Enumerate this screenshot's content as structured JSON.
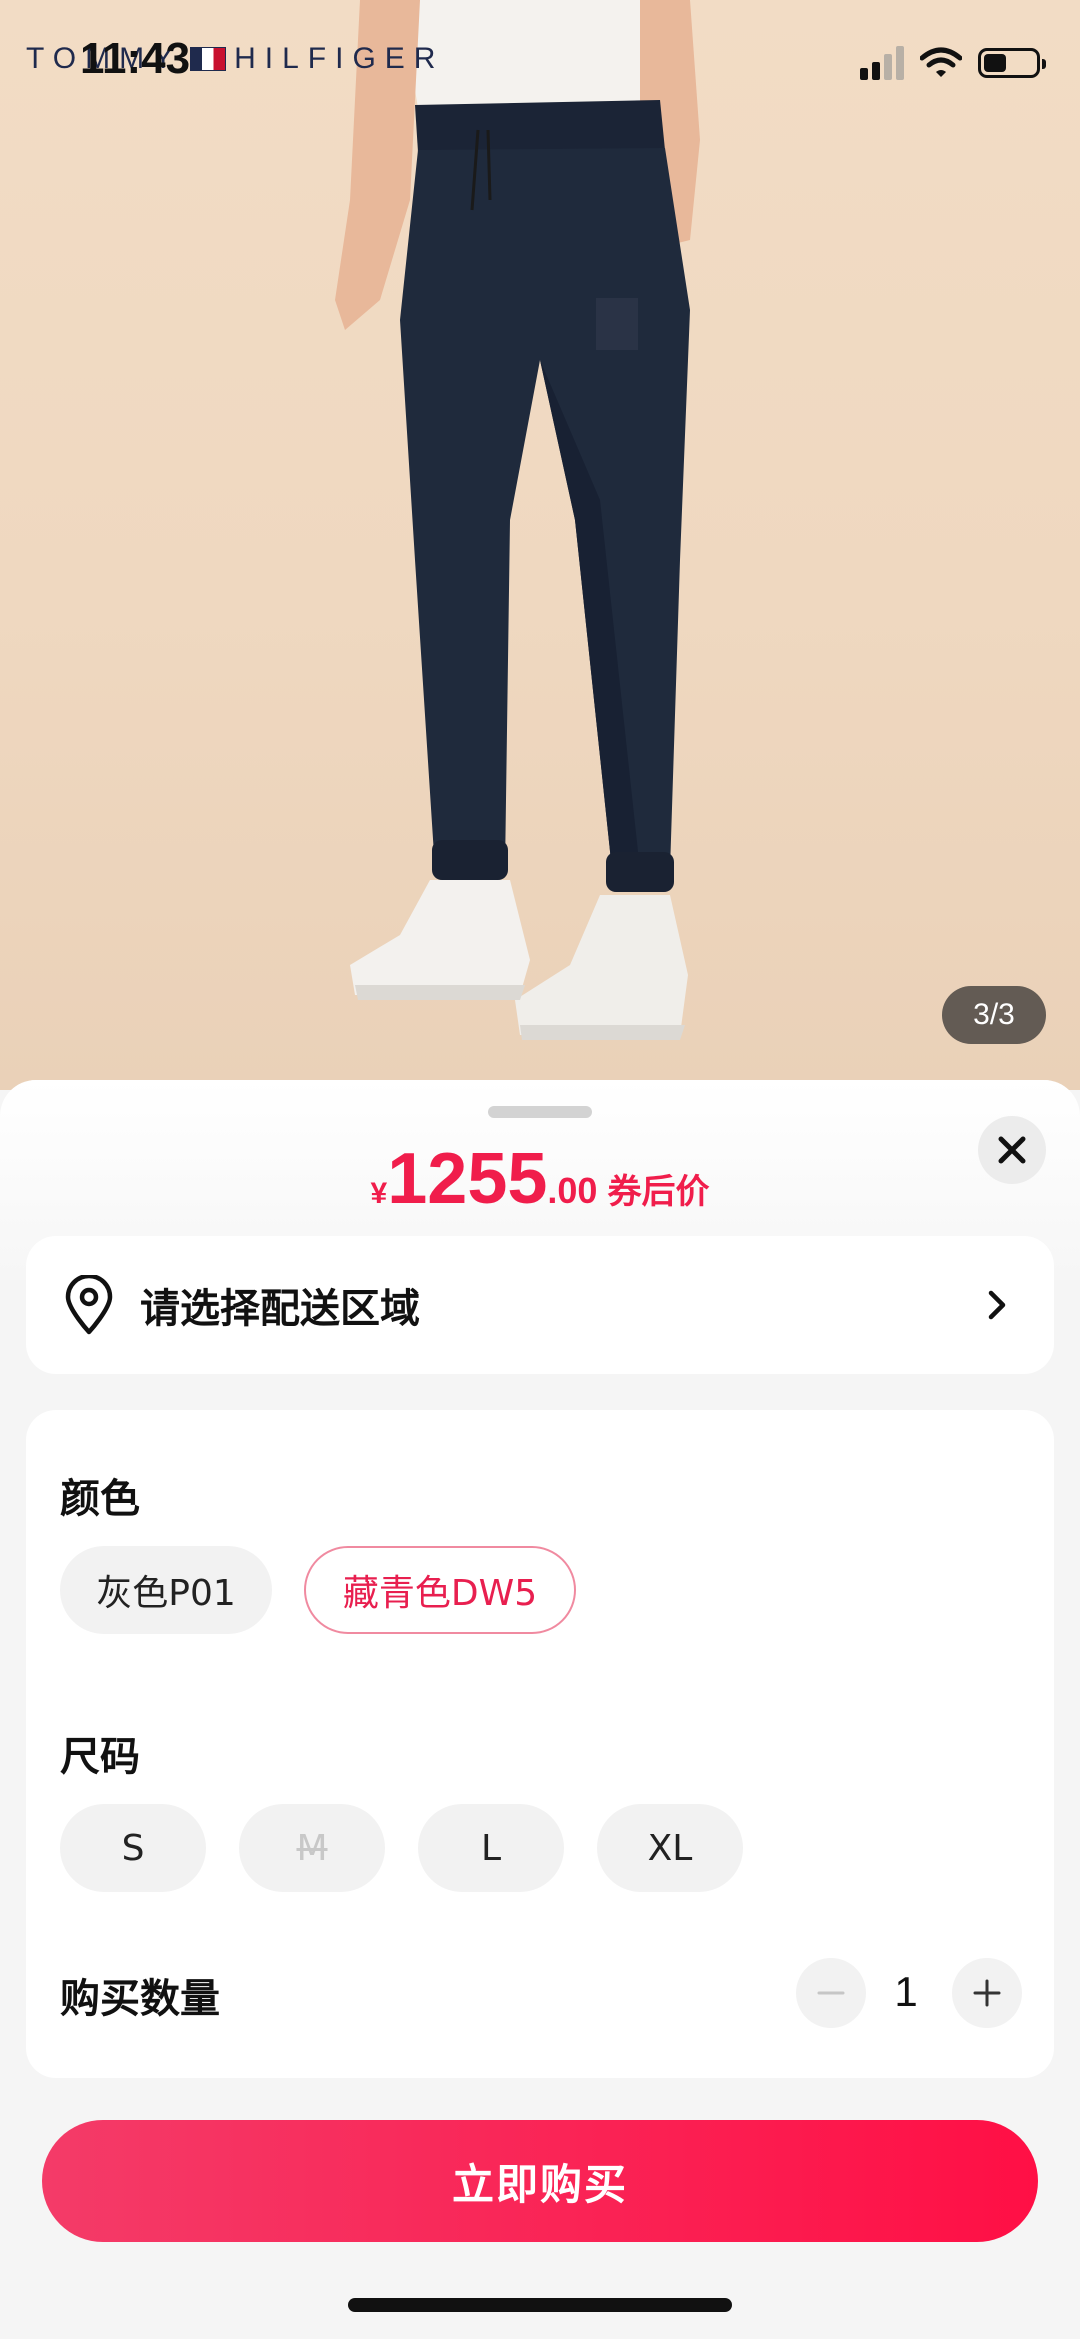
{
  "status_bar": {
    "time": "11:43"
  },
  "brand": {
    "left": "TOMMY",
    "right": "HILFIGER"
  },
  "gallery": {
    "indicator": "3/3"
  },
  "price": {
    "currency": "¥",
    "integer": "1255",
    "decimal": ".00",
    "note": "券后价",
    "color": "#f01d4b"
  },
  "delivery": {
    "label": "请选择配送区域",
    "icon": "location-pin-icon"
  },
  "color_section": {
    "title": "颜色",
    "options": [
      "灰色P01",
      "藏青色DW5"
    ],
    "selected": "藏青色DW5"
  },
  "size_section": {
    "title": "尺码",
    "options": [
      "S",
      "M",
      "L",
      "XL"
    ],
    "unavailable": [
      "M"
    ]
  },
  "quantity_section": {
    "title": "购买数量",
    "value": "1"
  },
  "buy_button": {
    "label": "立即购买",
    "color": "#ff1a4f"
  }
}
